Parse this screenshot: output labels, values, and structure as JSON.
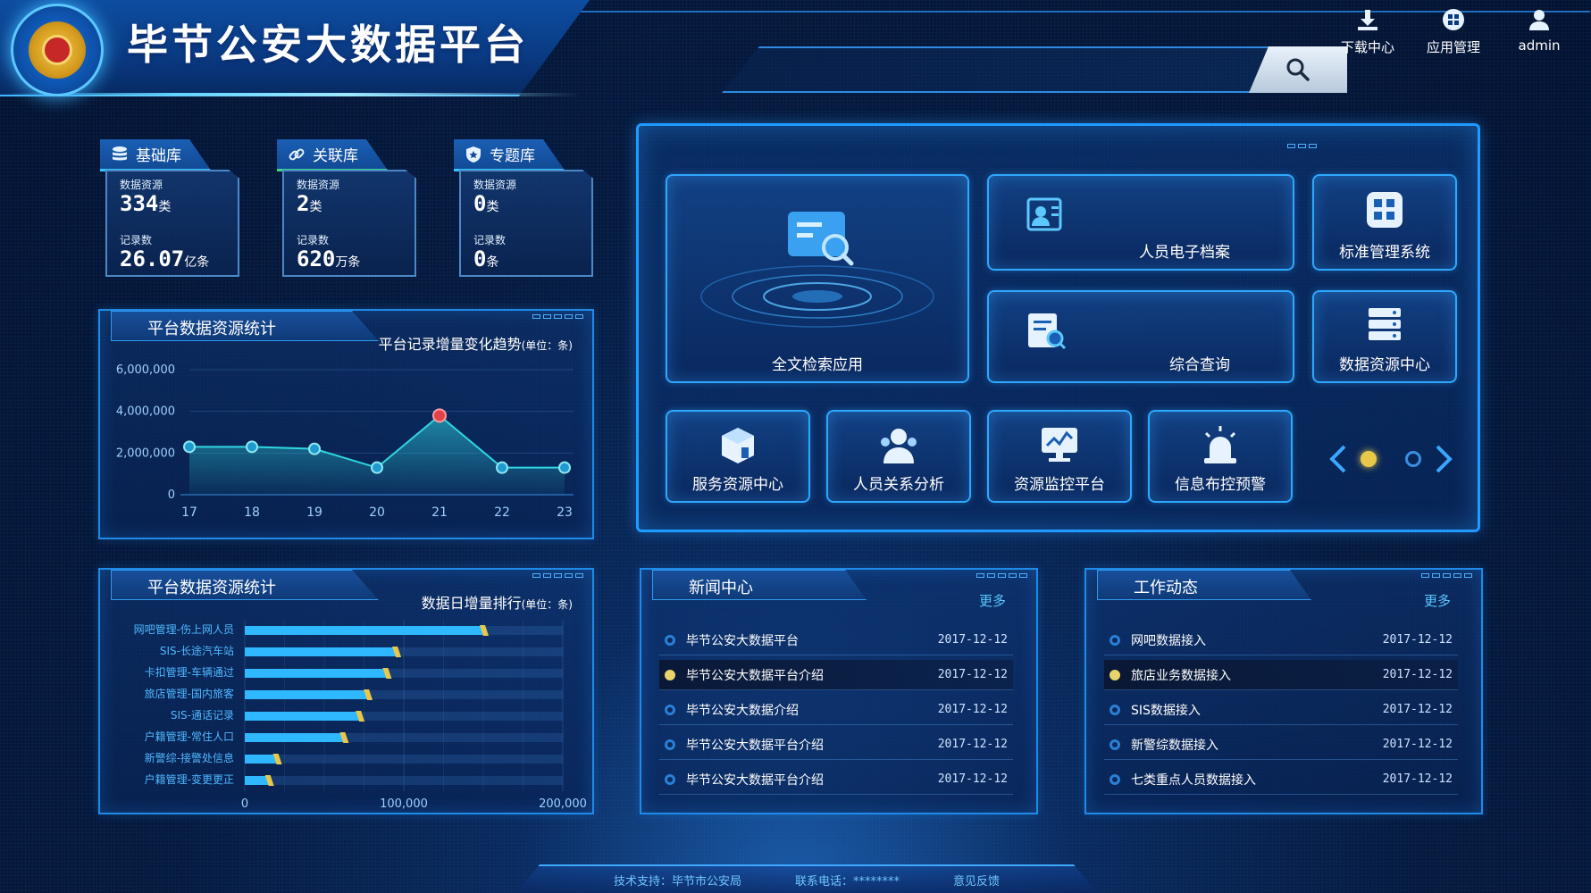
{
  "header": {
    "title": "毕节公安大数据平台",
    "search_placeholder": "",
    "nav": [
      {
        "label": "下载中心",
        "icon": "download-icon"
      },
      {
        "label": "应用管理",
        "icon": "grid-icon"
      },
      {
        "label": "admin",
        "icon": "user-icon"
      }
    ]
  },
  "stats": [
    {
      "tab": "基础库",
      "icon": "database-icon",
      "resource_label": "数据资源",
      "resource_value": "334",
      "resource_unit": "类",
      "record_label": "记录数",
      "record_value": "26.07",
      "record_unit": "亿条"
    },
    {
      "tab": "关联库",
      "icon": "link-icon",
      "resource_label": "数据资源",
      "resource_value": "2",
      "resource_unit": "类",
      "record_label": "记录数",
      "record_value": "620",
      "record_unit": "万条"
    },
    {
      "tab": "专题库",
      "icon": "shield-icon",
      "resource_label": "数据资源",
      "resource_value": "0",
      "resource_unit": "类",
      "record_label": "记录数",
      "record_value": "0",
      "record_unit": "条"
    }
  ],
  "trend_panel": {
    "tab": "平台数据资源统计",
    "subhead": "平台记录增量变化趋势",
    "unit": "(单位：条)"
  },
  "rank_panel": {
    "tab": "平台数据资源统计",
    "subhead": "数据日增量排行",
    "unit": "(单位：条)"
  },
  "chart_data": [
    {
      "type": "area",
      "x": [
        "17",
        "18",
        "19",
        "20",
        "21",
        "22",
        "23"
      ],
      "values": [
        2300000,
        2300000,
        2200000,
        1300000,
        3800000,
        1300000,
        1300000
      ],
      "highlight_index": 4,
      "ylim": [
        0,
        6000000
      ],
      "yticks": [
        "0",
        "2,000,000",
        "4,000,000",
        "6,000,000"
      ],
      "color": "#2fd6e0"
    },
    {
      "type": "bar",
      "orientation": "horizontal",
      "categories": [
        "网吧管理-伤上网人员",
        "SIS-长途汽车站",
        "卡扣管理-车辆通过",
        "旅店管理-国内旅客",
        "SIS-通话记录",
        "户籍管理-常住人口",
        "新警综-接警处信息",
        "户籍管理-变更更正"
      ],
      "values": [
        150000,
        95000,
        89000,
        77000,
        72000,
        62000,
        20000,
        15000
      ],
      "xlim": [
        0,
        200000
      ],
      "xticks": [
        "0",
        "100,000",
        "200,000"
      ],
      "color": "#2fb8ff"
    }
  ],
  "apps": {
    "big": {
      "label": "全文检索应用",
      "icon": "fulltext-search-icon"
    },
    "tiles": [
      {
        "label": "人员电子档案",
        "icon": "person-file-icon"
      },
      {
        "label": "标准管理系统",
        "icon": "standard-grid-icon"
      },
      {
        "label": "综合查询",
        "icon": "query-document-icon"
      },
      {
        "label": "数据资源中心",
        "icon": "server-icon"
      },
      {
        "label": "服务资源中心",
        "icon": "cube-icon"
      },
      {
        "label": "人员关系分析",
        "icon": "people-icon"
      },
      {
        "label": "资源监控平台",
        "icon": "monitor-icon"
      },
      {
        "label": "信息布控预警",
        "icon": "alarm-icon"
      }
    ]
  },
  "news": {
    "tab": "新闻中心",
    "more": "更多",
    "items": [
      {
        "title": "毕节公安大数据平台",
        "date": "2017-12-12"
      },
      {
        "title": "毕节公安大数据平台介绍",
        "date": "2017-12-12"
      },
      {
        "title": "毕节公安大数据介绍",
        "date": "2017-12-12"
      },
      {
        "title": "毕节公安大数据平台介绍",
        "date": "2017-12-12"
      },
      {
        "title": "毕节公安大数据平台介绍",
        "date": "2017-12-12"
      }
    ]
  },
  "work": {
    "tab": "工作动态",
    "more": "更多",
    "items": [
      {
        "title": "网吧数据接入",
        "date": "2017-12-12"
      },
      {
        "title": "旅店业务数据接入",
        "date": "2017-12-12"
      },
      {
        "title": "SIS数据接入",
        "date": "2017-12-12"
      },
      {
        "title": "新警综数据接入",
        "date": "2017-12-12"
      },
      {
        "title": "七类重点人员数据接入",
        "date": "2017-12-12"
      }
    ]
  },
  "footer": {
    "support": "技术支持：毕节市公安局",
    "phone": "联系电话：********",
    "feedback": "意见反馈"
  },
  "colors": {
    "accent": "#2ea8ff",
    "highlight_point": "#e0424a",
    "active_dot": "#e8c84a"
  }
}
